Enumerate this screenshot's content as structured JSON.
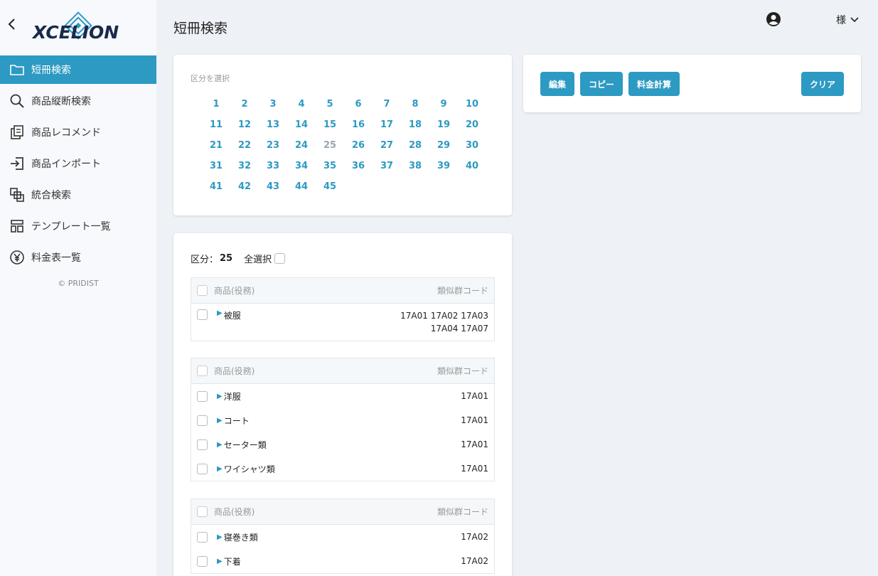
{
  "app": {
    "logo_text": "XCELION",
    "copyright": "© PRIDIST"
  },
  "sidebar": {
    "items": [
      {
        "label": "短冊検索",
        "icon": "folder-icon",
        "active": true
      },
      {
        "label": "商品縦断検索",
        "icon": "search-icon"
      },
      {
        "label": "商品レコメンド",
        "icon": "recommend-icon"
      },
      {
        "label": "商品インポート",
        "icon": "import-icon"
      },
      {
        "label": "統合検索",
        "icon": "integrated-search-icon"
      },
      {
        "label": "テンプレート一覧",
        "icon": "template-icon"
      },
      {
        "label": "料金表一覧",
        "icon": "yen-icon"
      }
    ]
  },
  "header": {
    "title": "短冊検索",
    "user_suffix": "様"
  },
  "kubun": {
    "label": "区分を選択",
    "selected": "25",
    "numbers": [
      "1",
      "2",
      "3",
      "4",
      "5",
      "6",
      "7",
      "8",
      "9",
      "10",
      "11",
      "12",
      "13",
      "14",
      "15",
      "16",
      "17",
      "18",
      "19",
      "20",
      "21",
      "22",
      "23",
      "24",
      "25",
      "26",
      "27",
      "28",
      "29",
      "30",
      "31",
      "32",
      "33",
      "34",
      "35",
      "36",
      "37",
      "38",
      "39",
      "40",
      "41",
      "42",
      "43",
      "44",
      "45"
    ]
  },
  "actions": {
    "edit": "編集",
    "copy": "コピー",
    "calc": "料金計算",
    "clear": "クリア"
  },
  "result": {
    "kubun_label": "区分：",
    "kubun_value": "25",
    "select_all": "全選択",
    "header_product": "商品(役務)",
    "header_code": "類似群コード",
    "groups": [
      {
        "rows": [
          {
            "name": "被服",
            "code_line1": "17A01 17A02 17A03",
            "code_line2": "17A04 17A07"
          }
        ]
      },
      {
        "rows": [
          {
            "name": "洋服",
            "code": "17A01"
          },
          {
            "name": "コート",
            "code": "17A01"
          },
          {
            "name": "セーター類",
            "code": "17A01"
          },
          {
            "name": "ワイシャツ類",
            "code": "17A01"
          }
        ]
      },
      {
        "rows": [
          {
            "name": "寝巻き類",
            "code": "17A02"
          },
          {
            "name": "下着",
            "code": "17A02"
          }
        ]
      }
    ]
  },
  "colors": {
    "accent": "#2c9ac2",
    "background": "#eef1f5"
  }
}
